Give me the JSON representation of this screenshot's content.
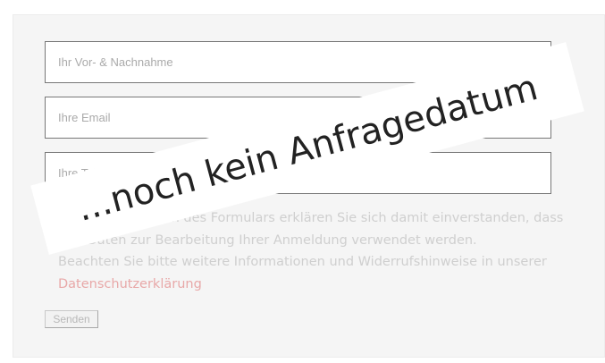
{
  "form": {
    "name_placeholder": "Ihr Vor- & Nachnahme",
    "email_placeholder": "Ihre Email",
    "phone_placeholder": "Ihre Telefonnummer",
    "consent_text": "Mit dem Absenden des Formulars erklären Sie sich damit einverstanden, dass Ihre Daten zur Bearbeitung Ihrer Anmeldung verwendet werden.",
    "info_text": "Beachten Sie bitte weitere Informationen und Widerrufshinweise in unserer",
    "privacy_link": "Datenschutzerklärung",
    "submit_label": "Senden"
  },
  "overlay": {
    "text": "...noch kein Anfragedatum"
  },
  "colors": {
    "panel_bg": "#f5f5f5",
    "field_border": "#777777",
    "link": "#e8a8a8",
    "overlay_bg": "#ffffff",
    "overlay_text": "#222222"
  }
}
